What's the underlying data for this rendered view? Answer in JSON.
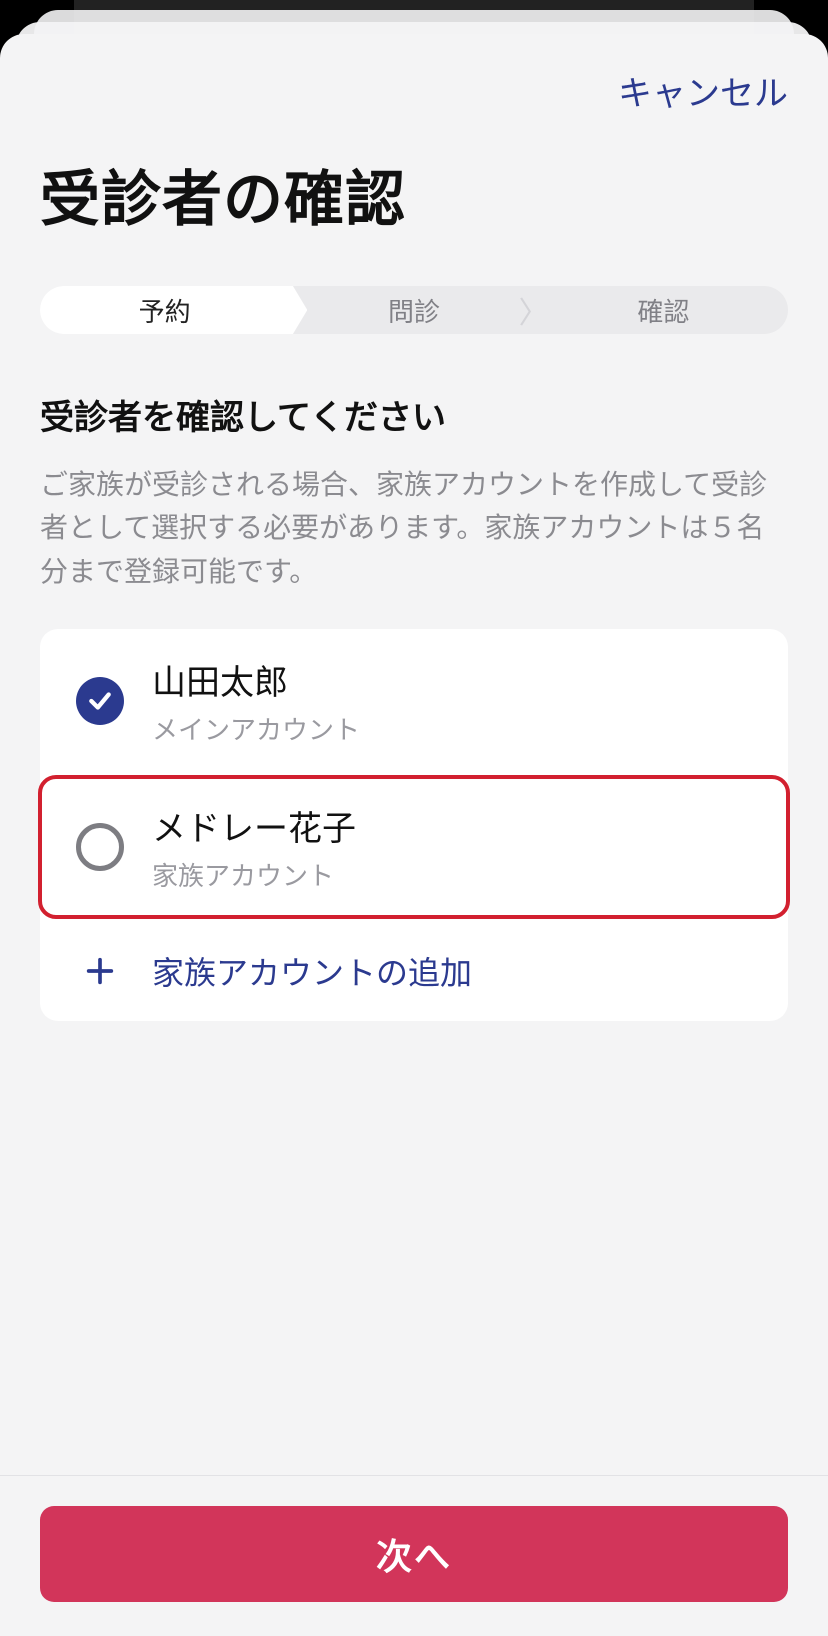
{
  "topbar": {
    "cancel": "キャンセル"
  },
  "title": "受診者の確認",
  "stepper": {
    "steps": [
      "予約",
      "問診",
      "確認"
    ],
    "activeIndex": 0
  },
  "section": {
    "heading": "受診者を確認してください",
    "description": "ご家族が受診される場合、家族アカウントを作成して受診者として選択する必要があります。家族アカウントは５名分まで登録可能です。"
  },
  "patients": [
    {
      "name": "山田太郎",
      "sub": "メインアカウント",
      "selected": true,
      "highlighted": false
    },
    {
      "name": "メドレー花子",
      "sub": "家族アカウント",
      "selected": false,
      "highlighted": true
    }
  ],
  "addFamily": {
    "label": "家族アカウントの追加"
  },
  "footer": {
    "next": "次へ"
  }
}
